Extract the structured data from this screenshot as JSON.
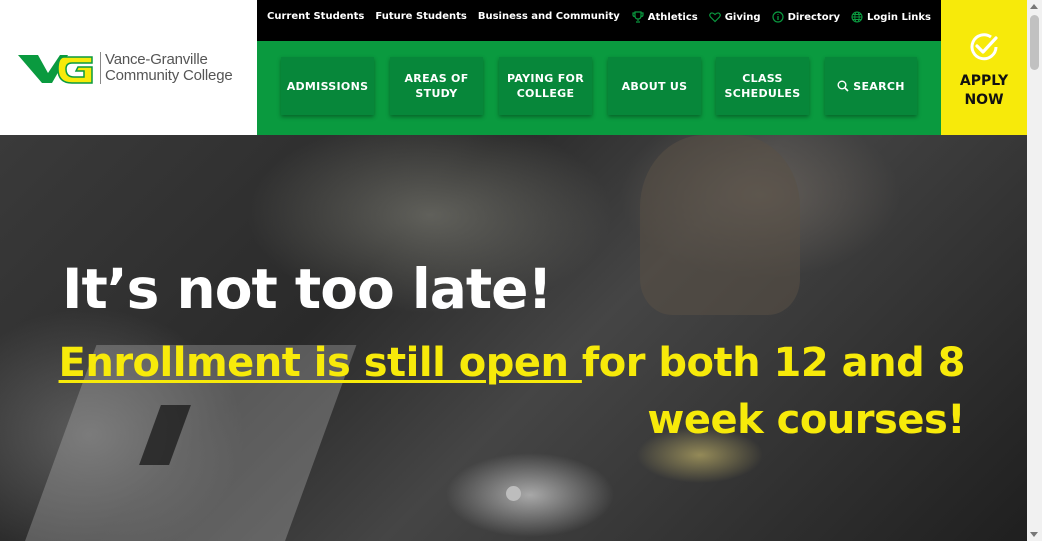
{
  "logo": {
    "mark_text": "VG",
    "line1": "Vance-Granville",
    "line2": "Community College",
    "colors": {
      "green": "#0a9a3f",
      "yellow": "#f7ea0a"
    }
  },
  "topbar": {
    "left_links": [
      "Current Students",
      "Future Students",
      "Business and Community"
    ],
    "right_links": [
      {
        "label": "Athletics",
        "icon": "trophy-icon"
      },
      {
        "label": "Giving",
        "icon": "heart-icon"
      },
      {
        "label": "Directory",
        "icon": "info-icon"
      },
      {
        "label": "Login Links",
        "icon": "globe-icon"
      }
    ]
  },
  "nav": {
    "items": [
      {
        "label": "ADMISSIONS"
      },
      {
        "label": "AREAS OF\nSTUDY"
      },
      {
        "label": "PAYING FOR\nCOLLEGE"
      },
      {
        "label": "ABOUT US"
      },
      {
        "label": "CLASS\nSCHEDULES"
      },
      {
        "label": "SEARCH",
        "icon": "search-icon"
      }
    ]
  },
  "apply": {
    "label": "APPLY\nNOW",
    "icon": "check-circle-icon"
  },
  "hero": {
    "title": "It’s not too late!",
    "link_text": "Enrollment is still open ",
    "rest_text": "for both 12 and 8 week courses!",
    "slide_count": 1
  },
  "colors": {
    "nav_green": "#0a9a3f",
    "nav_button": "#07873a",
    "accent_yellow": "#f7ea0a",
    "topbar_black": "#000000"
  }
}
